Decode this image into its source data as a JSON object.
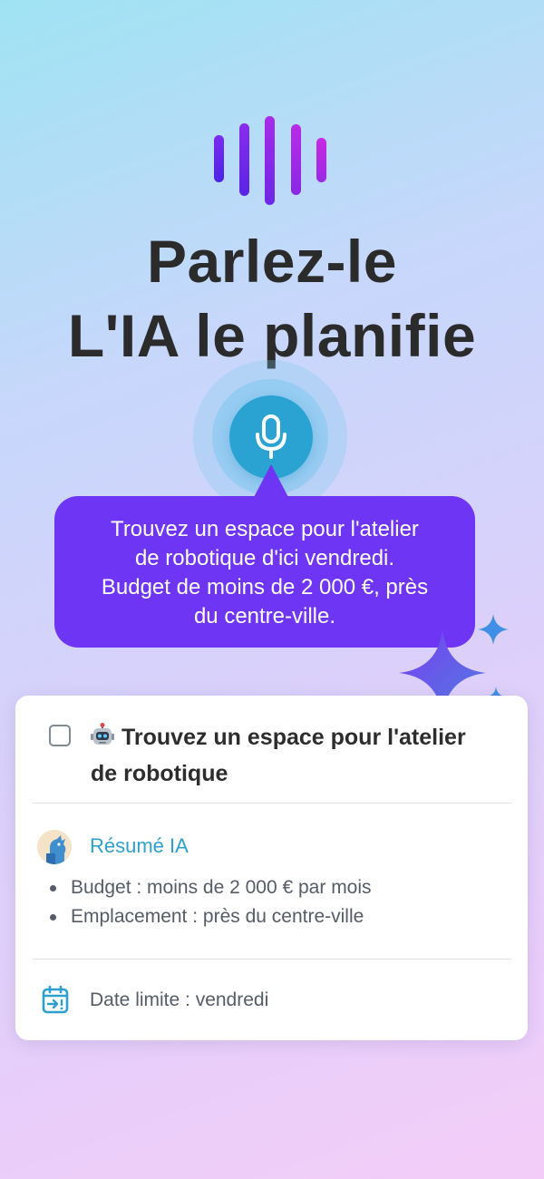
{
  "hero": {
    "title_line1": "Parlez-le",
    "title_line2": "L'IA le planifie"
  },
  "mic": {
    "icon": "microphone-icon"
  },
  "speech_bubble": {
    "lines": [
      "Trouvez un espace pour l'atelier",
      "de robotique d'ici vendredi.",
      "Budget de moins de 2 000 €, près",
      "du centre-ville."
    ]
  },
  "task_card": {
    "checked": false,
    "icon": "robot-icon",
    "title_line1": "Trouvez un espace pour l'atelier",
    "title_line2": "de robotique",
    "ai_summary": {
      "label": "Résumé IA",
      "items": [
        "Budget : moins de 2 000 € par mois",
        "Emplacement : près du centre-ville"
      ]
    },
    "deadline": {
      "icon": "calendar-icon",
      "label": "Date limite : vendredi"
    }
  },
  "colors": {
    "accent_purple": "#6f35f5",
    "mic_blue": "#2aa3d2",
    "ai_label_blue": "#2ea0cc",
    "title_dark": "#2b2b2b"
  }
}
